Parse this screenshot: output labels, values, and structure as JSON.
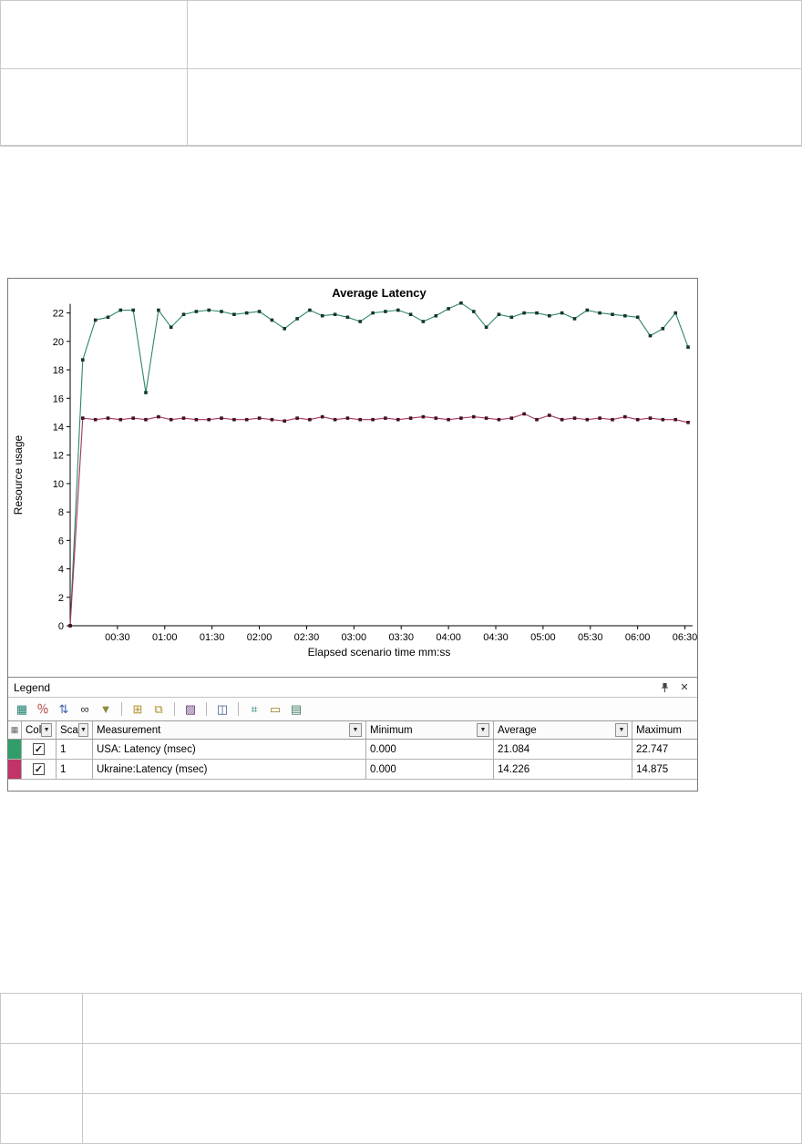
{
  "chart_data": {
    "type": "line",
    "title": "Average Latency",
    "xlabel": "Elapsed scenario time mm:ss",
    "ylabel": "Resource usage",
    "ylim": [
      0,
      23
    ],
    "xlim": [
      0,
      392
    ],
    "x_step": 8,
    "grid": false,
    "yticks": [
      0,
      2,
      4,
      6,
      8,
      10,
      12,
      14,
      16,
      18,
      20,
      22
    ],
    "xticks": [
      {
        "t": 30,
        "label": "00:30"
      },
      {
        "t": 60,
        "label": "01:00"
      },
      {
        "t": 90,
        "label": "01:30"
      },
      {
        "t": 120,
        "label": "02:00"
      },
      {
        "t": 150,
        "label": "02:30"
      },
      {
        "t": 180,
        "label": "03:00"
      },
      {
        "t": 210,
        "label": "03:30"
      },
      {
        "t": 240,
        "label": "04:00"
      },
      {
        "t": 270,
        "label": "04:30"
      },
      {
        "t": 300,
        "label": "05:00"
      },
      {
        "t": 330,
        "label": "05:30"
      },
      {
        "t": 360,
        "label": "06:00"
      },
      {
        "t": 390,
        "label": "06:30"
      }
    ],
    "series": [
      {
        "name": "USA: Latency (msec)",
        "color": "#2e8763",
        "marker": "#14382a",
        "values": [
          0,
          18.7,
          21.5,
          21.7,
          22.2,
          22.2,
          16.4,
          22.2,
          21.0,
          21.9,
          22.1,
          22.2,
          22.1,
          21.9,
          22.0,
          22.1,
          21.5,
          20.9,
          21.6,
          22.2,
          21.8,
          21.9,
          21.7,
          21.4,
          22.0,
          22.1,
          22.2,
          21.9,
          21.4,
          21.8,
          22.3,
          22.7,
          22.1,
          21.0,
          21.9,
          21.7,
          22.0,
          22.0,
          21.8,
          22.0,
          21.6,
          22.2,
          22.0,
          21.9,
          21.8,
          21.7,
          20.4,
          20.9,
          22.0,
          19.6
        ]
      },
      {
        "name": "Ukraine:Latency (msec)",
        "color": "#a63562",
        "marker": "#401026",
        "values": [
          0,
          14.6,
          14.5,
          14.6,
          14.5,
          14.6,
          14.5,
          14.7,
          14.5,
          14.6,
          14.5,
          14.5,
          14.6,
          14.5,
          14.5,
          14.6,
          14.5,
          14.4,
          14.6,
          14.5,
          14.7,
          14.5,
          14.6,
          14.5,
          14.5,
          14.6,
          14.5,
          14.6,
          14.7,
          14.6,
          14.5,
          14.6,
          14.7,
          14.6,
          14.5,
          14.6,
          14.9,
          14.5,
          14.8,
          14.5,
          14.6,
          14.5,
          14.6,
          14.5,
          14.7,
          14.5,
          14.6,
          14.5,
          14.5,
          14.3
        ]
      }
    ]
  },
  "legend": {
    "title": "Legend",
    "close_glyph": "✕",
    "toolbar": [
      {
        "name": "show-hide-graph-icon",
        "glyph": "▦",
        "color": "#1e7f6e"
      },
      {
        "name": "configure-measurements-icon",
        "glyph": "％",
        "color": "#b23434"
      },
      {
        "name": "sort-measurements-icon",
        "glyph": "⇅",
        "color": "#3b62a8"
      },
      {
        "name": "view-measurement-description-icon",
        "glyph": "∞",
        "color": "#333333"
      },
      {
        "name": "filter-icon",
        "glyph": "▼",
        "color": "#8c8c3a"
      },
      {
        "sep": true
      },
      {
        "name": "export-to-excel-icon",
        "glyph": "⊞",
        "color": "#b08f2a"
      },
      {
        "name": "copy-graph-icon",
        "glyph": "⧉",
        "color": "#b08f2a"
      },
      {
        "sep": true
      },
      {
        "name": "graph-settings-icon",
        "glyph": "▨",
        "color": "#6a3a7a"
      },
      {
        "sep": true
      },
      {
        "name": "select-columns-icon",
        "glyph": "◫",
        "color": "#3b5b8c"
      },
      {
        "sep": true
      },
      {
        "name": "web-page-diagnostics-icon",
        "glyph": "⌗",
        "color": "#1e7f6e"
      },
      {
        "name": "ruler-icon",
        "glyph": "▭",
        "color": "#9a7d20"
      },
      {
        "name": "list-view-icon",
        "glyph": "▤",
        "color": "#3f7d5d"
      }
    ],
    "columns": [
      {
        "label": "",
        "icon": true,
        "arrow": false
      },
      {
        "label": "Col",
        "icon": false,
        "arrow": true
      },
      {
        "label": "Sca",
        "icon": false,
        "arrow": true
      },
      {
        "label": "Measurement",
        "icon": false,
        "arrow": true
      },
      {
        "label": "Minimum",
        "icon": false,
        "arrow": true
      },
      {
        "label": "Average",
        "icon": false,
        "arrow": true
      },
      {
        "label": "Maximum",
        "icon": false,
        "arrow": false
      }
    ],
    "rows": [
      {
        "swatch": "#2f9e68",
        "checked": true,
        "scale": "1",
        "measurement": "USA: Latency (msec)",
        "minimum": "0.000",
        "average": "21.084",
        "maximum": "22.747"
      },
      {
        "swatch": "#c23367",
        "checked": true,
        "scale": "1",
        "measurement": "Ukraine:Latency (msec)",
        "minimum": "0.000",
        "average": "14.226",
        "maximum": "14.875"
      }
    ]
  }
}
